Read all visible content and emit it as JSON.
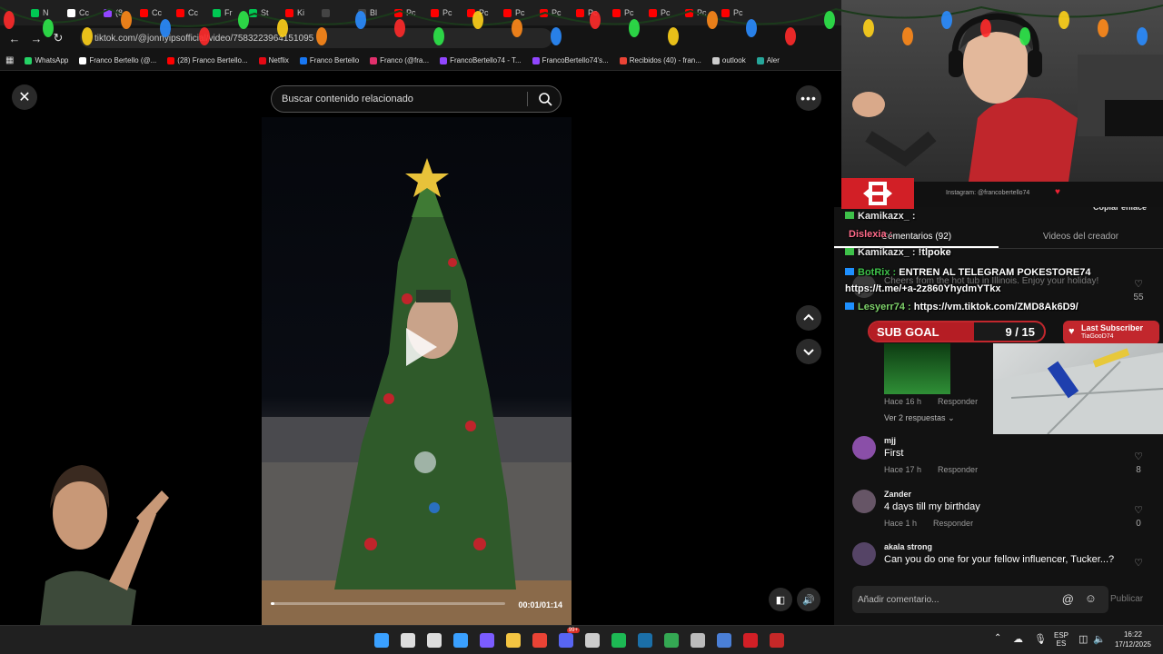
{
  "browser": {
    "tabs": [
      {
        "label": "N",
        "color": "#00c853"
      },
      {
        "label": "Cc",
        "color": "#ffffff"
      },
      {
        "label": "(8",
        "color": "#9146ff"
      },
      {
        "label": "Cc",
        "color": "#ff0000"
      },
      {
        "label": "Cc",
        "color": "#ff0000"
      },
      {
        "label": "Fr",
        "color": "#00c853"
      },
      {
        "label": "St",
        "color": "#00c853"
      },
      {
        "label": "Ki",
        "color": "#ff0000"
      },
      {
        "label": "",
        "color": "#444444"
      },
      {
        "label": "Bl",
        "color": "#444444"
      },
      {
        "label": "Pc",
        "color": "#ff0000"
      },
      {
        "label": "Pc",
        "color": "#ff0000"
      },
      {
        "label": "Pc",
        "color": "#ff0000"
      },
      {
        "label": "Pc",
        "color": "#ff0000"
      },
      {
        "label": "Pc",
        "color": "#ff0000"
      },
      {
        "label": "Pc",
        "color": "#ff0000"
      },
      {
        "label": "Pc",
        "color": "#ff0000"
      },
      {
        "label": "Pc",
        "color": "#ff0000"
      },
      {
        "label": "Pc",
        "color": "#ff0000"
      },
      {
        "label": "Pc",
        "color": "#ff0000"
      }
    ],
    "url": "tiktok.com/@jonnyipsofficial/video/7583223964151095",
    "bookmarks": [
      {
        "label": "WhatsApp",
        "color": "#25d366"
      },
      {
        "label": "Franco Bertello (@...",
        "color": "#ffffff"
      },
      {
        "label": "(28) Franco Bertello...",
        "color": "#ff0000"
      },
      {
        "label": "Netflix",
        "color": "#e50914"
      },
      {
        "label": "Franco Bertello",
        "color": "#1877f2"
      },
      {
        "label": "Franco (@fra...",
        "color": "#e1306c"
      },
      {
        "label": "FrancoBertello74 - T...",
        "color": "#9146ff"
      },
      {
        "label": "FrancoBertello74's...",
        "color": "#9146ff"
      },
      {
        "label": "Recibidos (40) - fran...",
        "color": "#ea4335"
      },
      {
        "label": "outlook",
        "color": "#cccccc"
      },
      {
        "label": "Aler",
        "color": "#26a69a"
      }
    ]
  },
  "viewer": {
    "search_placeholder": "Buscar contenido relacionado",
    "time": "00:01/01:14",
    "progress": 0.014
  },
  "panel": {
    "copy_link": "Copiar enlace",
    "tab_comments": "Comentarios (92)",
    "tab_creator": "Videos del creador",
    "replies_toggle": "Ver 2 respuestas",
    "comment_placeholder": "Añadir comentario...",
    "publish": "Publicar",
    "comments": [
      {
        "user": "",
        "text": "Cheers from the hot tub in Illinois. Enjoy your holiday!",
        "time": "Hace 16 h",
        "reply": "Responder",
        "likes": "55",
        "avatar": "#3a3a3a"
      },
      {
        "user": "mjj",
        "text": "First",
        "time": "Hace 17 h",
        "reply": "Responder",
        "likes": "8",
        "avatar": "#8a4fa8"
      },
      {
        "user": "Zander",
        "text": "4 days till my birthday",
        "time": "Hace 1 h",
        "reply": "Responder",
        "likes": "0",
        "avatar": "#665566"
      },
      {
        "user": "akala strong",
        "text": "Can you do one for your fellow influencer, Tucker...?",
        "time": "",
        "reply": "",
        "likes": "",
        "avatar": "#554466"
      }
    ]
  },
  "overlay": {
    "instagram": "Instagram: @francobertello74",
    "subgoal_label": "SUB GOAL",
    "subgoal_count": "9 / 15",
    "subgoal_progress": 0.6,
    "last_sub_title": "Last Subscriber",
    "last_sub_name": "TiaGooD74"
  },
  "chat": [
    {
      "user": "Kamikazx_",
      "sep": " : ",
      "msg": "",
      "ucolor": "#e6e6e6",
      "badge": "#3ec14a"
    },
    {
      "user": "Dislexia",
      "sep": " : ",
      "msg": "",
      "ucolor": "#ff6b8a",
      "badge": ""
    },
    {
      "user": "Kamikazx_",
      "sep": " : ",
      "msg": "!tlpoke",
      "ucolor": "#e6e6e6",
      "badge": "#3ec14a"
    },
    {
      "user": "BotRix",
      "sep": " : ",
      "msg": "ENTREN AL TELEGRAM POKESTORE74",
      "ucolor": "#3ec14a",
      "badge": "#1e90ff"
    },
    {
      "user": "",
      "sep": "",
      "msg": "https://t.me/+a-2z860YhydmYTkx",
      "ucolor": "#ffffff",
      "badge": ""
    },
    {
      "user": "Lesyerr74",
      "sep": " : ",
      "msg": "https://vm.tiktok.com/ZMD8Ak6D9/",
      "ucolor": "#7fd36b",
      "badge": "#1e90ff"
    }
  ],
  "taskbar": {
    "lang_top": "ESP",
    "lang_bottom": "ES",
    "time": "16:22",
    "date": "17/12/2025",
    "discord_badge": "99+",
    "icons": [
      {
        "name": "windows-start-icon",
        "color": "#3aa0ff"
      },
      {
        "name": "search-icon",
        "color": "#dddddd"
      },
      {
        "name": "task-view-icon",
        "color": "#dddddd"
      },
      {
        "name": "store-icon",
        "color": "#3aa0ff"
      },
      {
        "name": "copilot-icon",
        "color": "#7b5cff"
      },
      {
        "name": "file-explorer-icon",
        "color": "#f4c542"
      },
      {
        "name": "chrome-icon",
        "color": "#ea4335"
      },
      {
        "name": "discord-icon",
        "color": "#5865f2"
      },
      {
        "name": "app-icon",
        "color": "#cccccc"
      },
      {
        "name": "spotify-icon",
        "color": "#1db954"
      },
      {
        "name": "steam-icon",
        "color": "#1b6fa8"
      },
      {
        "name": "drive-icon",
        "color": "#34a853"
      },
      {
        "name": "tool-icon",
        "color": "#bbbbbb"
      },
      {
        "name": "monitor-icon",
        "color": "#4a7fd6"
      },
      {
        "name": "obs-icon",
        "color": "#d21f26"
      },
      {
        "name": "shield-icon",
        "color": "#c62828"
      }
    ]
  },
  "colors": {
    "accent_red": "#c2272d",
    "tiktok_bg": "#121212"
  }
}
